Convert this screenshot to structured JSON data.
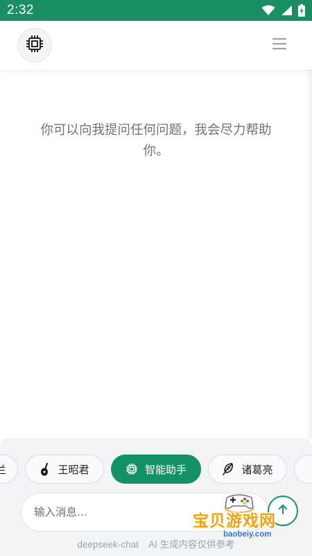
{
  "status_bar": {
    "time": "2:32",
    "icons": [
      "wifi-icon",
      "cell-signal-icon",
      "battery-charging-icon"
    ]
  },
  "header": {
    "logo_icon": "chip-icon",
    "menu_icon": "hamburger-menu-icon"
  },
  "welcome_message": "你可以向我提问任何问题，我会尽力帮助你。",
  "characters": [
    {
      "label": "兰",
      "icon": "none"
    },
    {
      "label": "王昭君",
      "icon": "pipa-icon"
    },
    {
      "label": "智能助手",
      "icon": "chip-icon",
      "active": true
    },
    {
      "label": "诸葛亮",
      "icon": "feather-fan-icon"
    },
    {
      "label": "",
      "icon": "none"
    }
  ],
  "input": {
    "placeholder": "输入消息...",
    "value": ""
  },
  "send_icon": "send-icon",
  "footer": {
    "model": "deepseek-chat",
    "disclaimer": "AI 生成内容仅供参考"
  },
  "watermark": {
    "title": "宝贝游戏网",
    "url": "baobeiy.com"
  },
  "colors": {
    "primary": "#129165",
    "status_bar": "#1a8f63",
    "panel_bg": "#f3f4f6",
    "watermark_orange": "#f2a20c",
    "watermark_blue": "#2f6fd1"
  }
}
